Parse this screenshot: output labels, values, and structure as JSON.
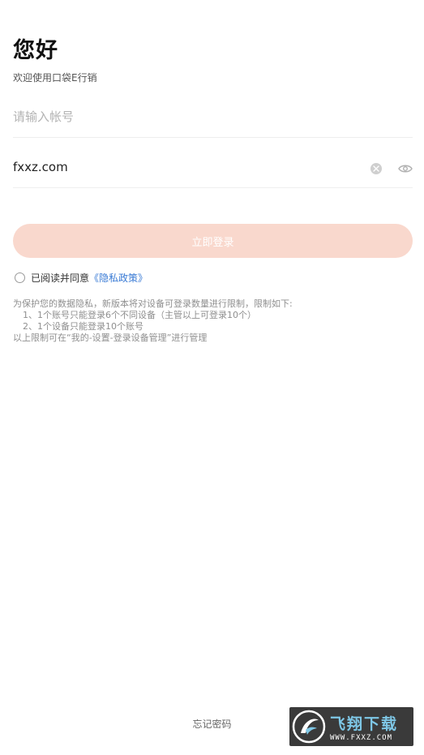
{
  "header": {
    "greeting": "您好",
    "welcome": "欢迎使用口袋E行销"
  },
  "form": {
    "account_placeholder": "请输入帐号",
    "account_value": "",
    "password_value": "fxxz.com",
    "clear_icon": "clear-icon",
    "visibility_icon": "eye-icon"
  },
  "login_button": "立即登录",
  "agreement": {
    "text": "已阅读并同意",
    "link": "《隐私政策》",
    "checked": false
  },
  "notice": {
    "line1": "为保护您的数据隐私，新版本将对设备可登录数量进行限制，限制如下:",
    "line2": "1、1个账号只能登录6个不同设备（主管以上可登录10个）",
    "line3": "2、1个设备只能登录10个账号",
    "line4": "以上限制可在“我的-设置-登录设备管理”进行管理"
  },
  "forgot_password": "忘记密码",
  "watermark": {
    "main": "飞翔下载",
    "sub": "WWW.FXXZ.COM"
  },
  "colors": {
    "button_bg": "#f9d8cd",
    "link": "#3a7bd5",
    "watermark_bg": "#3a3a3a",
    "watermark_text": "#7ec7e6"
  }
}
